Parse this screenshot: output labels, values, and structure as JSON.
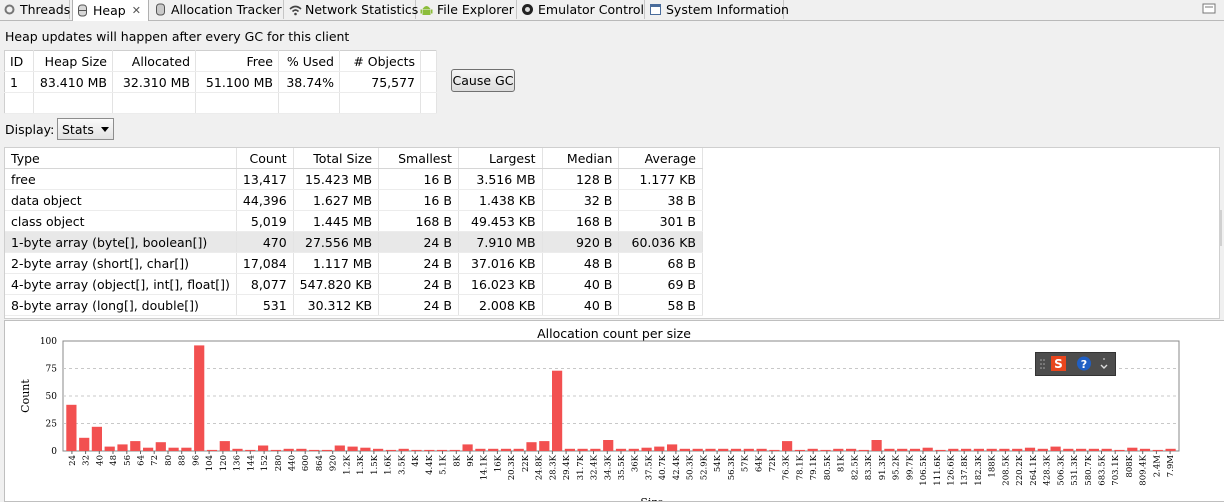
{
  "tabs": [
    {
      "label": "Threads",
      "icon": "threads-icon"
    },
    {
      "label": "Heap",
      "icon": "heap-icon",
      "active": true
    },
    {
      "label": "Allocation Tracker",
      "icon": "allocation-tracker-icon"
    },
    {
      "label": "Network Statistics",
      "icon": "wifi-icon"
    },
    {
      "label": "File Explorer",
      "icon": "android-icon"
    },
    {
      "label": "Emulator Control",
      "icon": "phone-icon"
    },
    {
      "label": "System Information",
      "icon": "window-icon"
    }
  ],
  "heap_notice": "Heap updates will happen after every GC for this client",
  "heap_table": {
    "headers": [
      "ID",
      "Heap Size",
      "Allocated",
      "Free",
      "% Used",
      "# Objects"
    ],
    "rows": [
      [
        "1",
        "83.410 MB",
        "32.310 MB",
        "51.100 MB",
        "38.74%",
        "75,577"
      ]
    ]
  },
  "cause_gc_label": "Cause GC",
  "display": {
    "label": "Display:",
    "selected": "Stats"
  },
  "stats_table": {
    "headers": [
      "Type",
      "Count",
      "Total Size",
      "Smallest",
      "Largest",
      "Median",
      "Average"
    ],
    "rows": [
      [
        "free",
        "13,417",
        "15.423 MB",
        "16 B",
        "3.516 MB",
        "128 B",
        "1.177 KB"
      ],
      [
        "data object",
        "44,396",
        "1.627 MB",
        "16 B",
        "1.438 KB",
        "32 B",
        "38 B"
      ],
      [
        "class object",
        "5,019",
        "1.445 MB",
        "168 B",
        "49.453 KB",
        "168 B",
        "301 B"
      ],
      [
        "1-byte array (byte[], boolean[])",
        "470",
        "27.556 MB",
        "24 B",
        "7.910 MB",
        "920 B",
        "60.036 KB"
      ],
      [
        "2-byte array (short[], char[])",
        "17,084",
        "1.117 MB",
        "24 B",
        "37.016 KB",
        "48 B",
        "68 B"
      ],
      [
        "4-byte array (object[], int[], float[])",
        "8,077",
        "547.820 KB",
        "24 B",
        "16.023 KB",
        "40 B",
        "69 B"
      ],
      [
        "8-byte array (long[], double[])",
        "531",
        "30.312 KB",
        "24 B",
        "2.008 KB",
        "40 B",
        "58 B"
      ]
    ],
    "selected_row": 3
  },
  "colors": {
    "bar": "#f25050",
    "selection": "#e8e8e8",
    "toolbar": "#4d4d4d",
    "help": "#1f5fc4",
    "s_logo": "#e8461e"
  },
  "chart_data": {
    "type": "bar",
    "title": "Allocation count per size",
    "xlabel": "Size",
    "ylabel": "Count",
    "ylim": [
      0,
      100
    ],
    "yticks": [
      0,
      25,
      50,
      75,
      100
    ],
    "grid": true,
    "categories": [
      "24",
      "32",
      "40",
      "48",
      "56",
      "64",
      "72",
      "80",
      "88",
      "96",
      "104",
      "120",
      "136",
      "144",
      "152",
      "280",
      "440",
      "600",
      "864",
      "920",
      "1.2K",
      "1.3K",
      "1.5K",
      "1.6K",
      "3.5K",
      "4K",
      "4.4K",
      "5.1K",
      "8K",
      "9K",
      "14.1K",
      "16K",
      "20.3K",
      "22K",
      "24.8K",
      "28.3K",
      "29.4K",
      "31.7K",
      "32.4K",
      "34.3K",
      "35.5K",
      "36K",
      "37.5K",
      "40.7K",
      "42.4K",
      "50.3K",
      "52.9K",
      "54K",
      "56.3K",
      "57K",
      "64K",
      "72K",
      "76.3K",
      "78.1K",
      "79.1K",
      "80.5K",
      "81K",
      "82.5K",
      "83.3K",
      "91.3K",
      "95.2K",
      "99.7K",
      "106.5K",
      "111.6K",
      "126.6K",
      "137.8K",
      "182.3K",
      "188K",
      "208.5K",
      "220.2K",
      "264.1K",
      "428.3K",
      "506.3K",
      "531.3K",
      "580.7K",
      "683.5K",
      "703.1K",
      "808K",
      "809.4K",
      "2.4M",
      "7.9M"
    ],
    "values": [
      42,
      12,
      22,
      4,
      6,
      9,
      3,
      8,
      3,
      3,
      96,
      1,
      9,
      2,
      1,
      5,
      1,
      2,
      2,
      1,
      1,
      5,
      4,
      3,
      2,
      1,
      2,
      1,
      1,
      1,
      1,
      6,
      2,
      2,
      2,
      2,
      8,
      9,
      73,
      2,
      2,
      2,
      10,
      2,
      2,
      3,
      4,
      6,
      2,
      2,
      2,
      2,
      2,
      2,
      2,
      1,
      9,
      1,
      2,
      1,
      2,
      2,
      1,
      10,
      2,
      2,
      2,
      3,
      1,
      2,
      2,
      2,
      2,
      2,
      2,
      3,
      2,
      4,
      2,
      2,
      2,
      2,
      1,
      3,
      2,
      1,
      2
    ]
  }
}
